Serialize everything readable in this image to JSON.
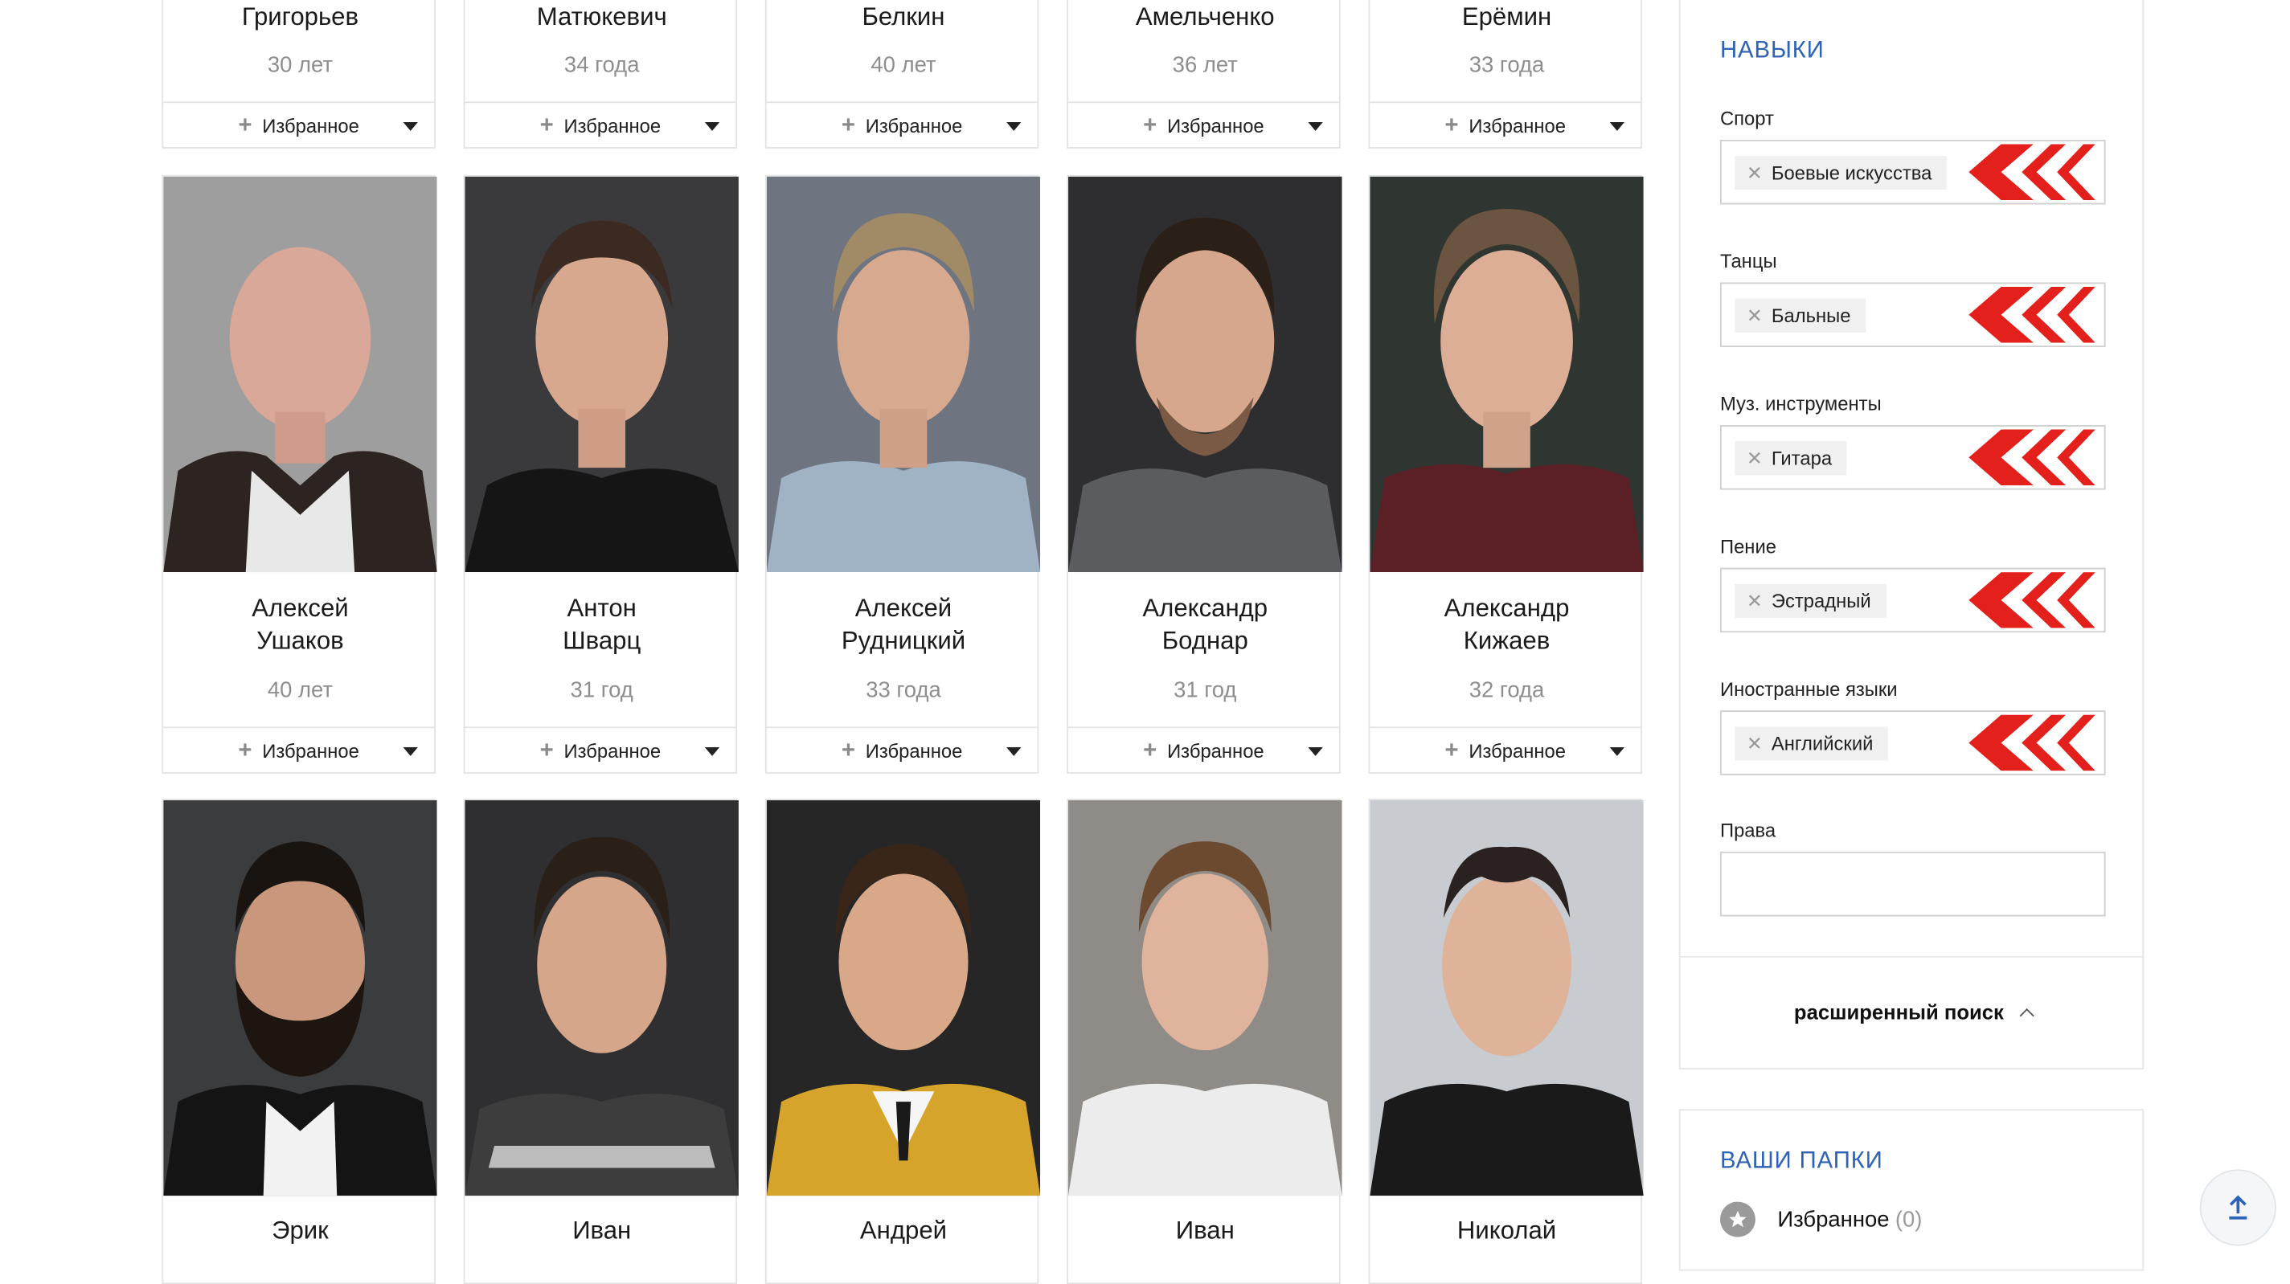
{
  "favorite_label": "Избранное",
  "row1": [
    {
      "surname": "Григорьев",
      "age": "30 лет"
    },
    {
      "surname": "Матюкевич",
      "age": "34 года"
    },
    {
      "surname": "Белкин",
      "age": "40 лет"
    },
    {
      "surname": "Амельченко",
      "age": "36 лет"
    },
    {
      "surname": "Ерёмин",
      "age": "33 года"
    }
  ],
  "row2": [
    {
      "first_name": "Алексей",
      "surname": "Ушаков",
      "age": "40 лет"
    },
    {
      "first_name": "Антон",
      "surname": "Шварц",
      "age": "31 год"
    },
    {
      "first_name": "Алексей",
      "surname": "Рудницкий",
      "age": "33 года"
    },
    {
      "first_name": "Александр",
      "surname": "Боднар",
      "age": "31 год"
    },
    {
      "first_name": "Александр",
      "surname": "Кижаев",
      "age": "32 года"
    }
  ],
  "row3": [
    {
      "first_name": "Эрик"
    },
    {
      "first_name": "Иван"
    },
    {
      "first_name": "Андрей"
    },
    {
      "first_name": "Иван"
    },
    {
      "first_name": "Николай"
    }
  ],
  "skills": {
    "title": "НАВЫКИ",
    "fields": [
      {
        "label": "Спорт",
        "value": "Боевые искусства"
      },
      {
        "label": "Танцы",
        "value": "Бальные"
      },
      {
        "label": "Муз. инструменты",
        "value": "Гитара"
      },
      {
        "label": "Пение",
        "value": "Эстрадный"
      },
      {
        "label": "Иностранные языки",
        "value": "Английский"
      }
    ],
    "rights_label": "Права",
    "advanced_search": "расширенный поиск"
  },
  "folders": {
    "title": "ВАШИ ПАПКИ",
    "favorites_label": "Избранное",
    "favorites_count": "(0)"
  },
  "colors": {
    "accent_blue": "#2d62b7",
    "arrow_red": "#e3201b"
  }
}
